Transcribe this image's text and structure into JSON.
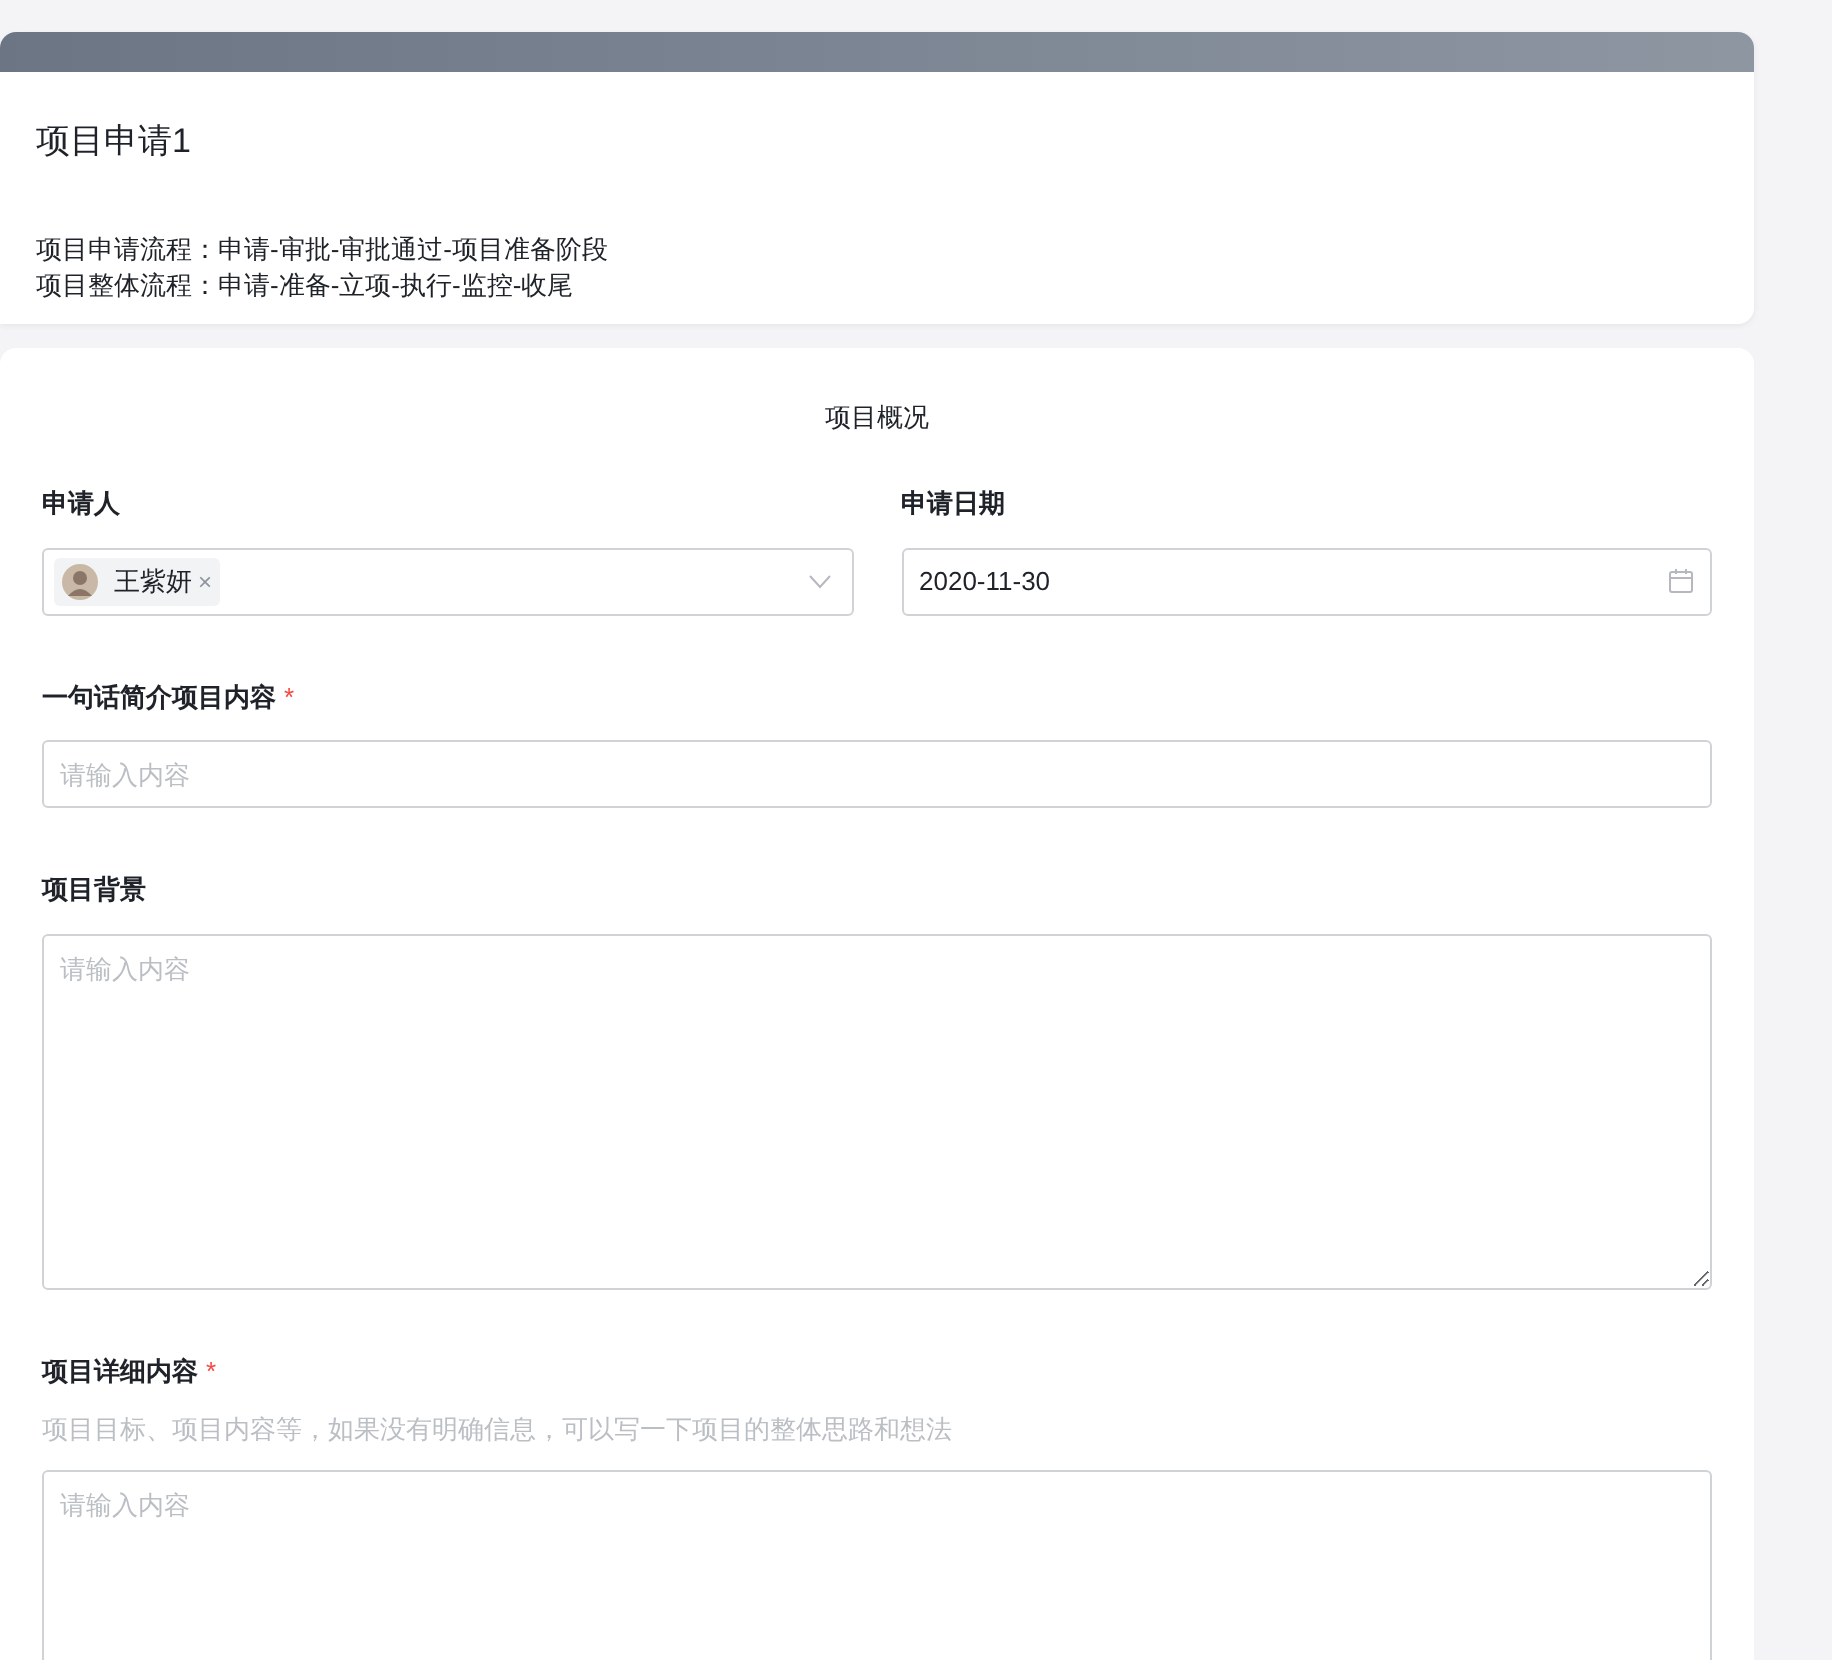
{
  "header": {
    "title": "项目申请1",
    "lines": [
      "项目申请流程：申请-审批-审批通过-项目准备阶段",
      "项目整体流程：申请-准备-立项-执行-监控-收尾"
    ]
  },
  "form": {
    "section_title": "项目概况",
    "fields": [
      {
        "kind": "person",
        "label": "申请人",
        "tags": [
          {
            "name": "王紫妍",
            "remove": "×"
          }
        ]
      },
      {
        "kind": "date",
        "label": "申请日期",
        "value": "2020-11-30"
      },
      {
        "kind": "text",
        "label": "一句话简介项目内容",
        "required_mark": "*",
        "placeholder": "请输入内容"
      },
      {
        "kind": "textarea",
        "label": "项目背景",
        "placeholder": "请输入内容"
      },
      {
        "kind": "textarea",
        "label": "项目详细内容",
        "required_mark": "*",
        "hint": "项目目标、项目内容等，如果没有明确信息，可以写一下项目的整体思路和想法",
        "placeholder": "请输入内容"
      }
    ]
  }
}
